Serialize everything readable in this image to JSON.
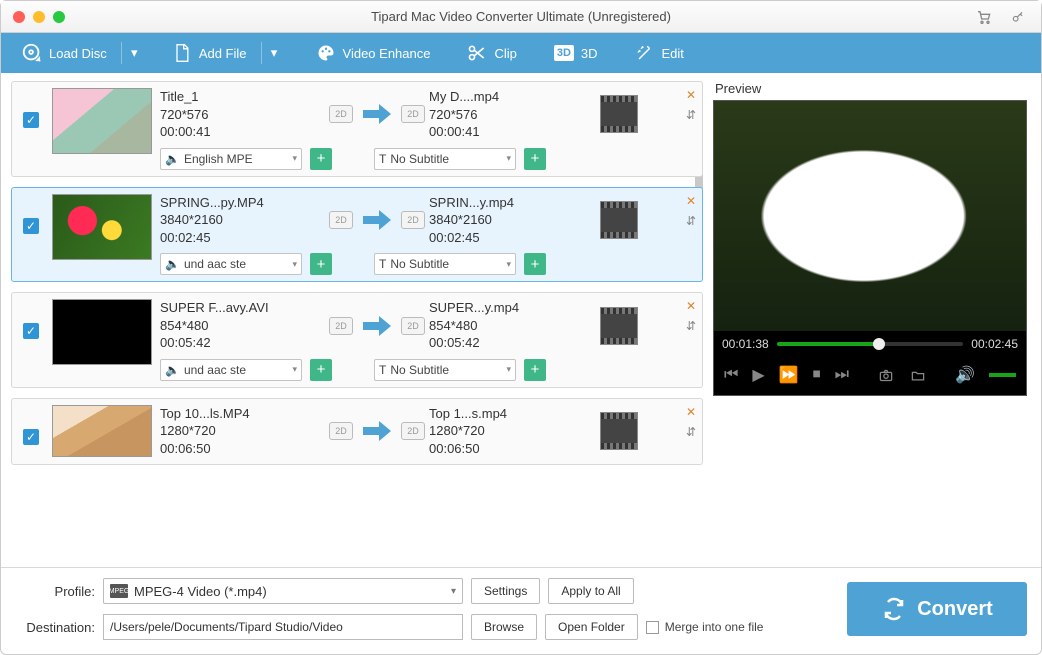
{
  "titlebar": {
    "title": "Tipard Mac Video Converter Ultimate (Unregistered)"
  },
  "toolbar": {
    "load_disc": "Load Disc",
    "add_file": "Add File",
    "video_enhance": "Video Enhance",
    "clip": "Clip",
    "three_d": "3D",
    "edit": "Edit"
  },
  "dropdowns": {
    "no_subtitle": "No Subtitle"
  },
  "items": [
    {
      "src_name": "Title_1",
      "src_res": "720*576",
      "src_dur": "00:00:41",
      "dst_name": "My D....mp4",
      "dst_res": "720*576",
      "dst_dur": "00:00:41",
      "audio": "English MPE"
    },
    {
      "src_name": "SPRING...py.MP4",
      "src_res": "3840*2160",
      "src_dur": "00:02:45",
      "dst_name": "SPRIN...y.mp4",
      "dst_res": "3840*2160",
      "dst_dur": "00:02:45",
      "audio": "und aac ste"
    },
    {
      "src_name": "SUPER F...avy.AVI",
      "src_res": "854*480",
      "src_dur": "00:05:42",
      "dst_name": "SUPER...y.mp4",
      "dst_res": "854*480",
      "dst_dur": "00:05:42",
      "audio": "und aac ste"
    },
    {
      "src_name": "Top 10...ls.MP4",
      "src_res": "1280*720",
      "src_dur": "00:06:50",
      "dst_name": "Top 1...s.mp4",
      "dst_res": "1280*720",
      "dst_dur": "00:06:50",
      "audio": ""
    }
  ],
  "preview": {
    "label": "Preview",
    "cur_time": "00:01:38",
    "total_time": "00:02:45"
  },
  "bottom": {
    "profile_label": "Profile:",
    "profile_value": "MPEG-4 Video (*.mp4)",
    "settings": "Settings",
    "apply_all": "Apply to All",
    "dest_label": "Destination:",
    "dest_value": "/Users/pele/Documents/Tipard Studio/Video",
    "browse": "Browse",
    "open_folder": "Open Folder",
    "merge": "Merge into one file",
    "convert": "Convert"
  }
}
